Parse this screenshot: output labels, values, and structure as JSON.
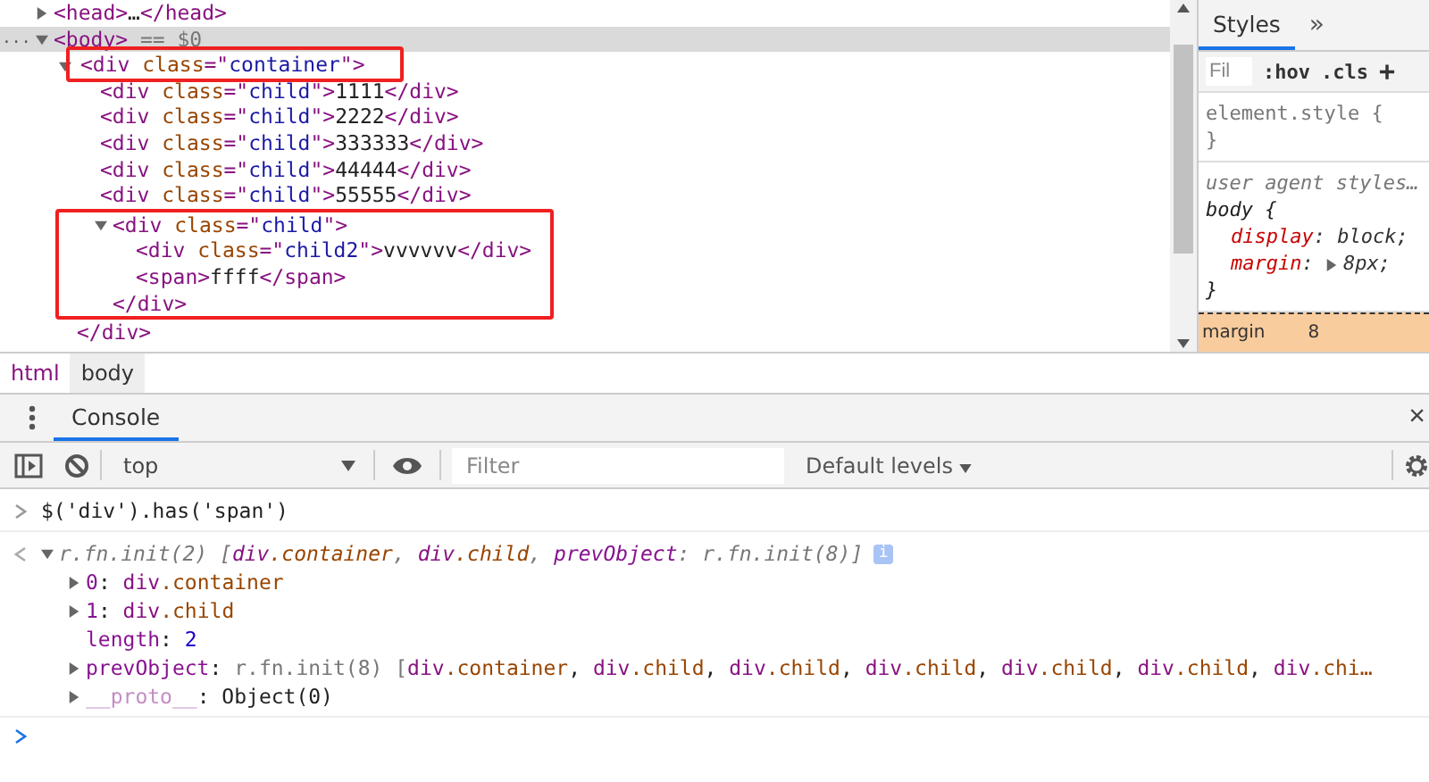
{
  "elements_tree": [
    {
      "expanded": false,
      "selected": false,
      "open": [
        {
          "kind": "tag",
          "text": "<head>"
        },
        {
          "kind": "text",
          "text": "…"
        },
        {
          "kind": "tag",
          "text": "</head>"
        }
      ]
    },
    {
      "menu": "...",
      "expanded": true,
      "selected": true,
      "open": [
        {
          "kind": "tag",
          "text": "<body>"
        },
        {
          "kind": "grey",
          "text": " == $0"
        }
      ],
      "children": [
        {
          "expanded": true,
          "selected": false,
          "boxed": true,
          "open": [
            {
              "kind": "tag",
              "text": "<div "
            },
            {
              "kind": "attr",
              "text": "class"
            },
            {
              "kind": "tag",
              "text": "=\""
            },
            {
              "kind": "value",
              "text": "container"
            },
            {
              "kind": "tag",
              "text": "\">"
            }
          ],
          "children": [
            {
              "selected": false,
              "open": [
                {
                  "kind": "tag",
                  "text": "<div "
                },
                {
                  "kind": "attr",
                  "text": "class"
                },
                {
                  "kind": "tag",
                  "text": "=\""
                },
                {
                  "kind": "value",
                  "text": "child"
                },
                {
                  "kind": "tag",
                  "text": "\">"
                },
                {
                  "kind": "text",
                  "text": "1111"
                },
                {
                  "kind": "tag",
                  "text": "</div>"
                }
              ]
            },
            {
              "selected": false,
              "open": [
                {
                  "kind": "tag",
                  "text": "<div "
                },
                {
                  "kind": "attr",
                  "text": "class"
                },
                {
                  "kind": "tag",
                  "text": "=\""
                },
                {
                  "kind": "value",
                  "text": "child"
                },
                {
                  "kind": "tag",
                  "text": "\">"
                },
                {
                  "kind": "text",
                  "text": "2222"
                },
                {
                  "kind": "tag",
                  "text": "</div>"
                }
              ]
            },
            {
              "selected": false,
              "open": [
                {
                  "kind": "tag",
                  "text": "<div "
                },
                {
                  "kind": "attr",
                  "text": "class"
                },
                {
                  "kind": "tag",
                  "text": "=\""
                },
                {
                  "kind": "value",
                  "text": "child"
                },
                {
                  "kind": "tag",
                  "text": "\">"
                },
                {
                  "kind": "text",
                  "text": "333333"
                },
                {
                  "kind": "tag",
                  "text": "</div>"
                }
              ]
            },
            {
              "selected": false,
              "open": [
                {
                  "kind": "tag",
                  "text": "<div "
                },
                {
                  "kind": "attr",
                  "text": "class"
                },
                {
                  "kind": "tag",
                  "text": "=\""
                },
                {
                  "kind": "value",
                  "text": "child"
                },
                {
                  "kind": "tag",
                  "text": "\">"
                },
                {
                  "kind": "text",
                  "text": "44444"
                },
                {
                  "kind": "tag",
                  "text": "</div>"
                }
              ]
            },
            {
              "selected": false,
              "open": [
                {
                  "kind": "tag",
                  "text": "<div "
                },
                {
                  "kind": "attr",
                  "text": "class"
                },
                {
                  "kind": "tag",
                  "text": "=\""
                },
                {
                  "kind": "value",
                  "text": "child"
                },
                {
                  "kind": "tag",
                  "text": "\">"
                },
                {
                  "kind": "text",
                  "text": "55555"
                },
                {
                  "kind": "tag",
                  "text": "</div>"
                }
              ]
            },
            {
              "expanded": true,
              "selected": false,
              "boxed_with_children": true,
              "open": [
                {
                  "kind": "tag",
                  "text": "<div "
                },
                {
                  "kind": "attr",
                  "text": "class"
                },
                {
                  "kind": "tag",
                  "text": "=\""
                },
                {
                  "kind": "value",
                  "text": "child"
                },
                {
                  "kind": "tag",
                  "text": "\">"
                }
              ],
              "children": [
                {
                  "selected": false,
                  "open": [
                    {
                      "kind": "tag",
                      "text": "<div "
                    },
                    {
                      "kind": "attr",
                      "text": "class"
                    },
                    {
                      "kind": "tag",
                      "text": "=\""
                    },
                    {
                      "kind": "value",
                      "text": "child2"
                    },
                    {
                      "kind": "tag",
                      "text": "\">"
                    },
                    {
                      "kind": "text",
                      "text": "vvvvvv"
                    },
                    {
                      "kind": "tag",
                      "text": "</div>"
                    }
                  ]
                },
                {
                  "selected": false,
                  "open": [
                    {
                      "kind": "tag",
                      "text": "<span>"
                    },
                    {
                      "kind": "text",
                      "text": "ffff"
                    },
                    {
                      "kind": "tag",
                      "text": "</span>"
                    }
                  ]
                }
              ],
              "close": [
                {
                  "kind": "tag",
                  "text": "</div>"
                }
              ]
            }
          ],
          "close": [
            {
              "kind": "tag",
              "text": "</div>"
            }
          ]
        }
      ]
    }
  ],
  "styles_pane": {
    "tabs": [
      {
        "label": "Styles",
        "selected": true
      }
    ],
    "more": "»",
    "filter_placeholder": "Fil",
    "hov": ":hov",
    "cls": ".cls",
    "add": "+",
    "rules": [
      {
        "kind": "inline",
        "selector": "element.style {",
        "close": "}"
      },
      {
        "kind": "agent",
        "origin": "user agent styles…",
        "selector": "body {",
        "declarations": [
          {
            "property": "display",
            "colon": ":",
            "value": "block;",
            "expandable": false
          },
          {
            "property": "margin",
            "colon": ":",
            "value": "8px;",
            "expandable": true
          }
        ],
        "close": "}"
      }
    ],
    "box_model": {
      "label": "margin",
      "value": "8"
    }
  },
  "breadcrumbs": [
    {
      "label": "html",
      "selected": false
    },
    {
      "label": "body",
      "selected": true
    }
  ],
  "drawer": {
    "tabs": [
      {
        "label": "Console",
        "selected": true
      }
    ],
    "close": "×"
  },
  "console_toolbar": {
    "context": "top",
    "filter_placeholder": "Filter",
    "levels": "Default levels"
  },
  "console": {
    "input": "$('div').has('span')",
    "result": {
      "expanded": true,
      "segments": [
        {
          "kind": "grey",
          "text": "r.fn.init(2) ["
        },
        {
          "kind": "tag",
          "text": "div"
        },
        {
          "kind": "attr",
          "text": ".container"
        },
        {
          "kind": "grey",
          "text": ", "
        },
        {
          "kind": "tag",
          "text": "div"
        },
        {
          "kind": "attr",
          "text": ".child"
        },
        {
          "kind": "grey",
          "text": ", "
        },
        {
          "kind": "key",
          "text": "prevObject"
        },
        {
          "kind": "grey",
          "text": ": r.fn.init(8)]"
        }
      ],
      "badge": "i",
      "properties": [
        {
          "expandable": true,
          "key": "0",
          "faded": false,
          "segments": [
            {
              "kind": "plain",
              "text": ": "
            },
            {
              "kind": "tag",
              "text": "div"
            },
            {
              "kind": "attr",
              "text": ".container"
            }
          ]
        },
        {
          "expandable": true,
          "key": "1",
          "faded": false,
          "segments": [
            {
              "kind": "plain",
              "text": ": "
            },
            {
              "kind": "tag",
              "text": "div"
            },
            {
              "kind": "attr",
              "text": ".child"
            }
          ]
        },
        {
          "expandable": false,
          "key": "length",
          "faded": false,
          "segments": [
            {
              "kind": "plain",
              "text": ": "
            },
            {
              "kind": "number",
              "text": "2"
            }
          ]
        },
        {
          "expandable": true,
          "key": "prevObject",
          "faded": false,
          "segments": [
            {
              "kind": "plain",
              "text": ": "
            },
            {
              "kind": "grey",
              "text": "r.fn.init(8) ["
            },
            {
              "kind": "tag",
              "text": "div"
            },
            {
              "kind": "attr",
              "text": ".container"
            },
            {
              "kind": "plain",
              "text": ", "
            },
            {
              "kind": "tag",
              "text": "div"
            },
            {
              "kind": "attr",
              "text": ".child"
            },
            {
              "kind": "plain",
              "text": ", "
            },
            {
              "kind": "tag",
              "text": "div"
            },
            {
              "kind": "attr",
              "text": ".child"
            },
            {
              "kind": "plain",
              "text": ", "
            },
            {
              "kind": "tag",
              "text": "div"
            },
            {
              "kind": "attr",
              "text": ".child"
            },
            {
              "kind": "plain",
              "text": ", "
            },
            {
              "kind": "tag",
              "text": "div"
            },
            {
              "kind": "attr",
              "text": ".child"
            },
            {
              "kind": "plain",
              "text": ", "
            },
            {
              "kind": "tag",
              "text": "div"
            },
            {
              "kind": "attr",
              "text": ".child"
            },
            {
              "kind": "plain",
              "text": ", "
            },
            {
              "kind": "tag",
              "text": "div"
            },
            {
              "kind": "attr",
              "text": ".chi…"
            }
          ]
        },
        {
          "expandable": true,
          "key": "__proto__",
          "faded": true,
          "segments": [
            {
              "kind": "plain",
              "text": ": "
            },
            {
              "kind": "plain",
              "text": "Object(0)"
            }
          ]
        }
      ]
    }
  }
}
